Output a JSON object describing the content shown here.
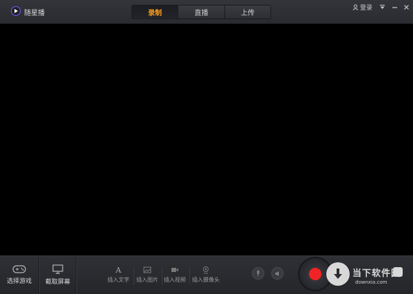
{
  "app": {
    "title": "随星播"
  },
  "tabs": [
    {
      "label": "录制",
      "active": true
    },
    {
      "label": "直播",
      "active": false
    },
    {
      "label": "上传",
      "active": false
    }
  ],
  "header": {
    "login_label": "登录"
  },
  "toolbar": {
    "select_game_label": "选择游戏",
    "capture_screen_label": "截取屏幕",
    "insert_text_label": "插入文字",
    "insert_image_label": "插入图片",
    "insert_video_label": "插入视频",
    "insert_camera_label": "插入摄像头"
  },
  "watermark": {
    "text": "当下软件园",
    "sub": "downxia.com"
  },
  "colors": {
    "accent": "#ff9d1d",
    "record": "#f02424",
    "logo": "#6d5cff"
  }
}
